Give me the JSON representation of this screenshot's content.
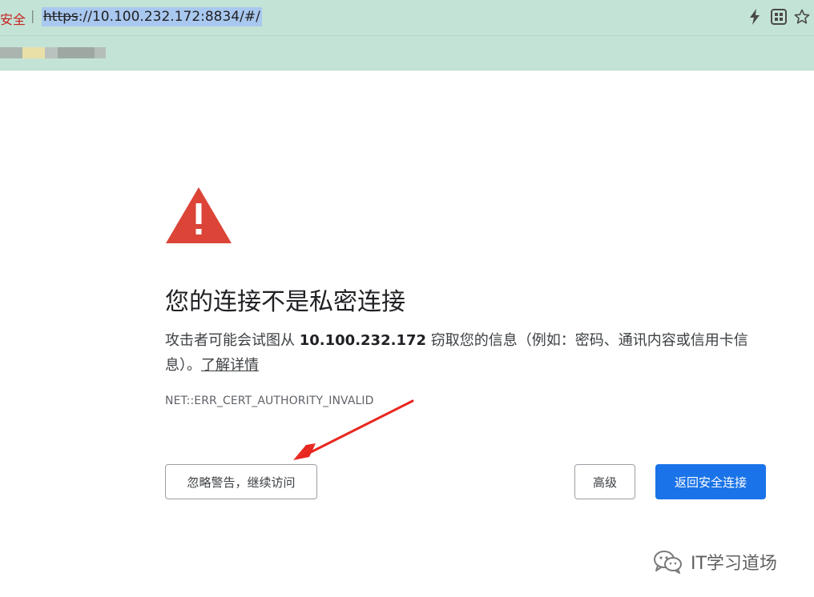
{
  "browser": {
    "security_label": "安全",
    "address_separator": "|",
    "url_scheme": "https",
    "url_rest": "://10.100.232.172:8834/#/",
    "icons": [
      "lightning-icon",
      "qr-code-icon",
      "star-icon"
    ]
  },
  "interstitial": {
    "heading": "您的连接不是私密连接",
    "explanation_prefix": "攻击者可能会试图从 ",
    "host": "10.100.232.172",
    "explanation_suffix": " 窃取您的信息（例如：密码、通讯内容或信用卡信息）。",
    "learn_more": "了解详情",
    "error_code": "NET::ERR_CERT_AUTHORITY_INVALID",
    "proceed_button": "忽略警告，继续访问",
    "advanced_button": "高级",
    "back_button": "返回安全连接"
  },
  "watermark": {
    "text": "IT学习道场"
  },
  "colors": {
    "chrome_bg": "#c3e3d6",
    "warning_red": "#db4437",
    "primary_blue": "#1a73e8",
    "annotation_red": "#e8261f"
  }
}
